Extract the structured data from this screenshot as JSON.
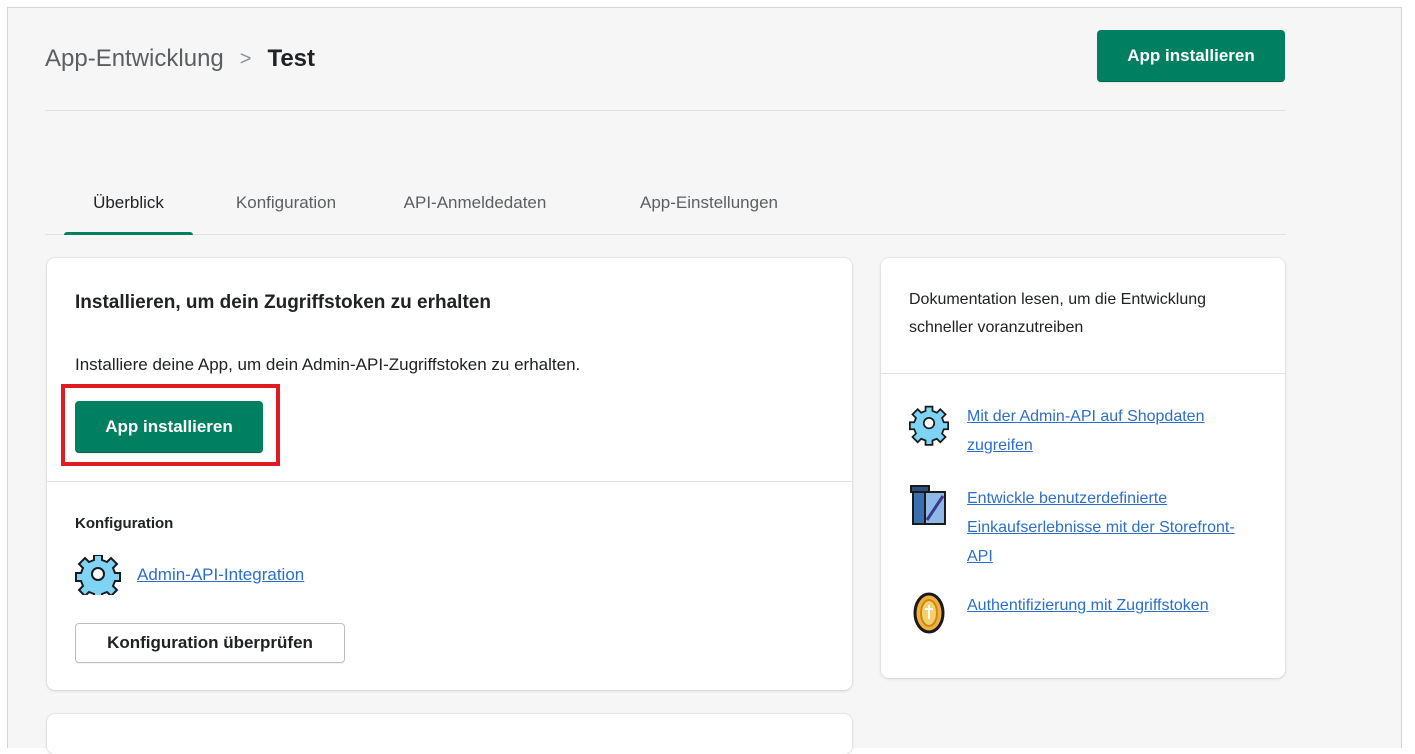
{
  "header": {
    "breadcrumb_parent": "App-Entwicklung",
    "breadcrumb_separator": ">",
    "breadcrumb_current": "Test",
    "install_button": "App installieren"
  },
  "tabs": [
    {
      "label": "Überblick",
      "active": true
    },
    {
      "label": "Konfiguration",
      "active": false
    },
    {
      "label": "API-Anmeldedaten",
      "active": false
    },
    {
      "label": "App-Einstellungen",
      "active": false
    }
  ],
  "main_card": {
    "title": "Installieren, um dein Zugriffstoken zu erhalten",
    "description": "Installiere deine App, um dein Admin-API-Zugriffstoken zu erhalten.",
    "install_button": "App installieren",
    "config_section": {
      "title": "Konfiguration",
      "link_icon": "gear-icon",
      "link": "Admin-API-Integration",
      "review_button": "Konfiguration überprüfen"
    }
  },
  "side_card": {
    "title": "Dokumentation lesen, um die Entwicklung schneller voranzutreiben",
    "items": [
      {
        "icon": "gear-icon",
        "label": "Mit der Admin-API auf Shopdaten zugreifen"
      },
      {
        "icon": "storefront-icon",
        "label": "Entwickle benutzerdefinierte Einkaufserlebnisse mit der Storefront-API"
      },
      {
        "icon": "token-coin-icon",
        "label": "Authentifizierung mit Zugriffstoken"
      }
    ]
  },
  "colors": {
    "primary": "#008060",
    "link": "#2c6ecb",
    "highlight_border": "#e01b22",
    "background": "#f6f6f7"
  }
}
